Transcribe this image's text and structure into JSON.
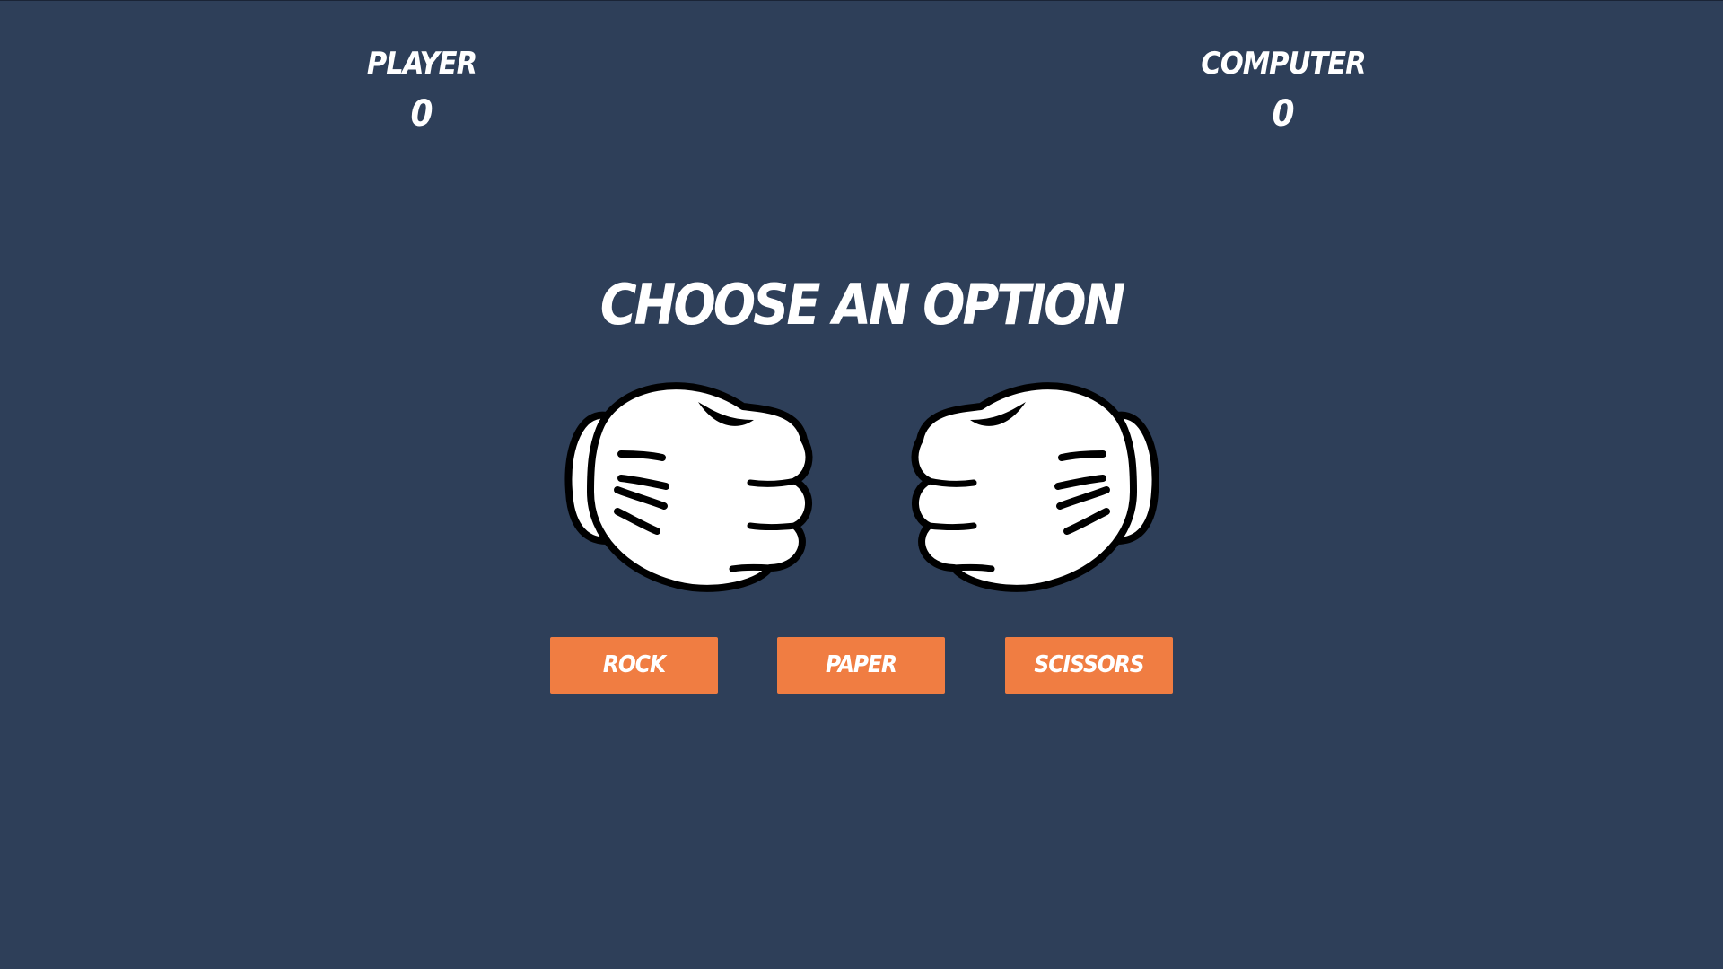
{
  "scoreboard": {
    "player_label": "PLAYER",
    "player_score": "0",
    "computer_label": "COMPUTER",
    "computer_score": "0"
  },
  "main": {
    "title": "CHOOSE AN OPTION"
  },
  "hands": {
    "player_icon": "fist-glove-icon",
    "computer_icon": "fist-glove-icon"
  },
  "buttons": {
    "rock": "ROCK",
    "paper": "PAPER",
    "scissors": "SCISSORS"
  },
  "colors": {
    "background": "#2e3f59",
    "button": "#f07d42",
    "text": "#ffffff"
  }
}
